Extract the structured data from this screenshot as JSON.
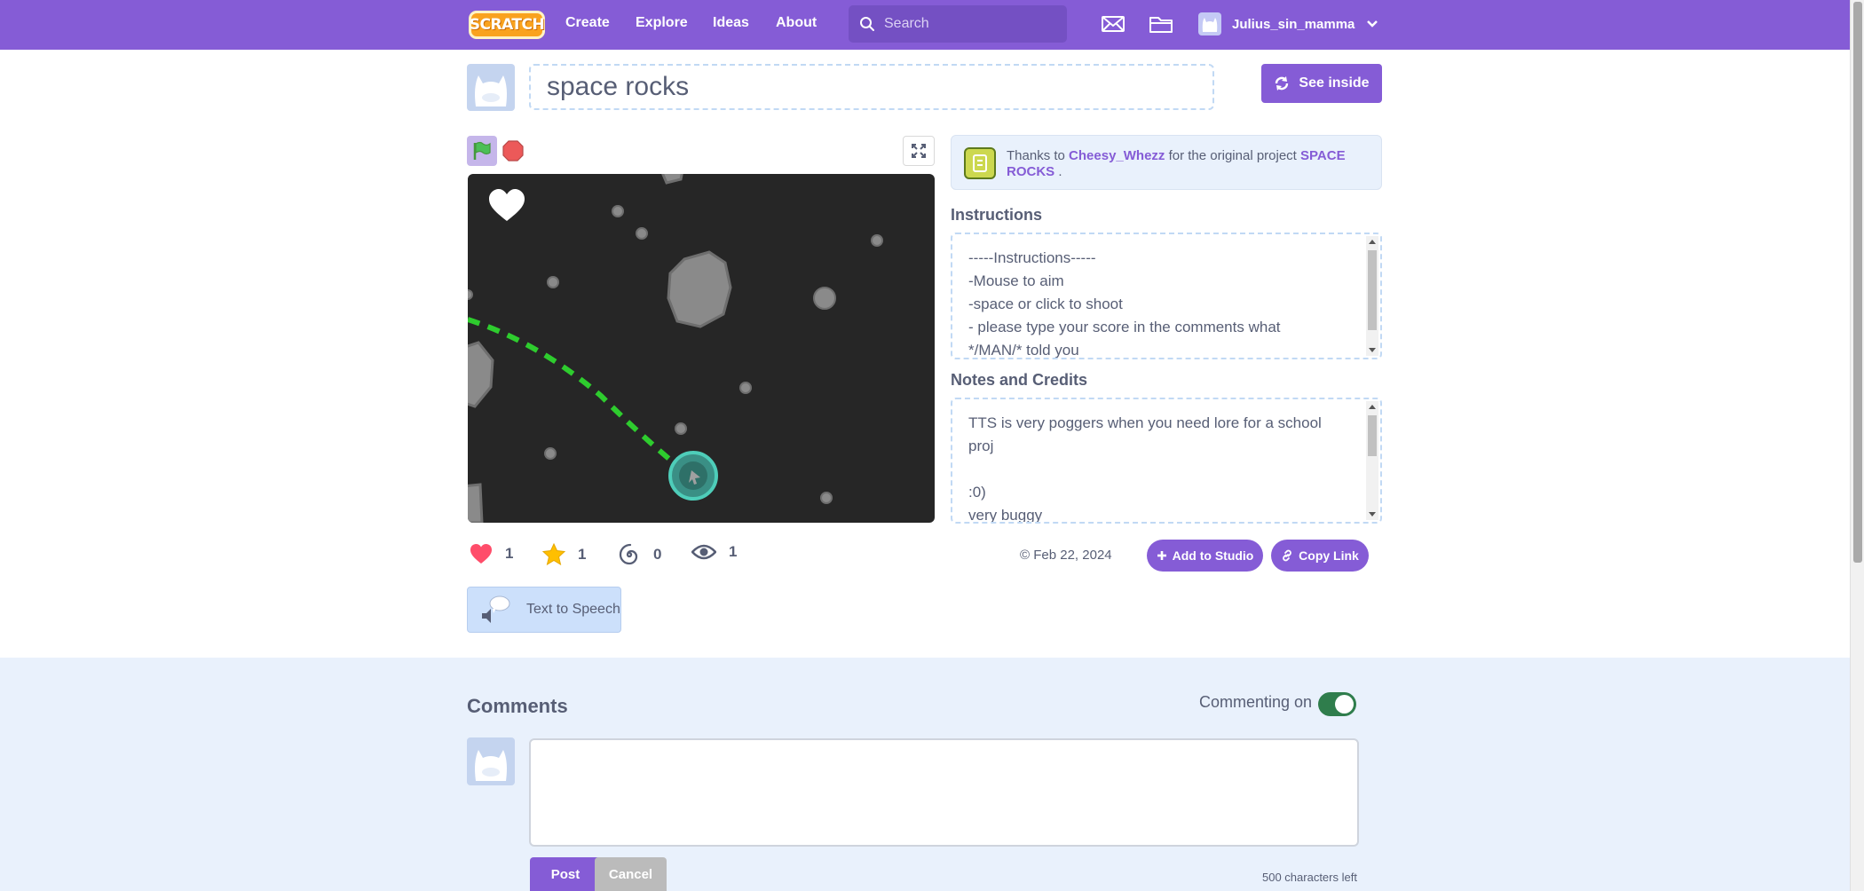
{
  "nav": {
    "logo_text": "SCRATCH",
    "links": [
      "Create",
      "Explore",
      "Ideas",
      "About"
    ],
    "search_placeholder": "Search",
    "username": "Julius_sin_mamma"
  },
  "project": {
    "title": "space rocks",
    "see_inside_label": "See inside"
  },
  "remix": {
    "prefix": "Thanks to",
    "author": "Cheesy_Whezz",
    "middle": "for the original project",
    "original_title": "SPACE ROCKS",
    "suffix": "."
  },
  "instructions": {
    "label": "Instructions",
    "text": "-----Instructions-----\n-Mouse to aim\n-space or click to shoot\n- please type your score in the comments what\n*/MAN/* told you"
  },
  "notes": {
    "label": "Notes and Credits",
    "text": "TTS is very poggers when you need lore for a school\nproj\n\n:0)\nvery buggy"
  },
  "stats": {
    "loves": "1",
    "favorites": "1",
    "remixes": "0",
    "views": "1"
  },
  "date": "© Feb 22, 2024",
  "add_to_studio_label": "Add to Studio",
  "copy_link_label": "Copy Link",
  "tts_label": "Text to Speech",
  "comments": {
    "title": "Comments",
    "commenting_label": "Commenting on",
    "commenting_on": true,
    "post_label": "Post",
    "cancel_label": "Cancel",
    "chars_left": "500 characters left"
  },
  "colors": {
    "brand": "#855cd6",
    "background_light": "#e9f1fc",
    "toggle_on": "#2f7d4c"
  }
}
